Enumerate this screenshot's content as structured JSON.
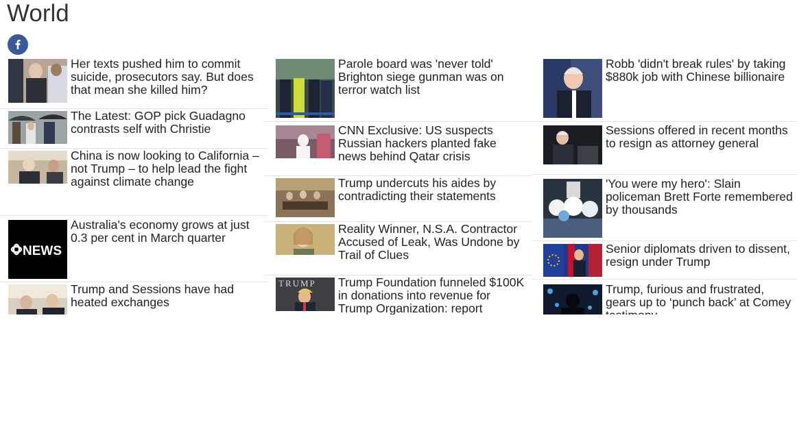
{
  "page": {
    "title": "World",
    "share_icon": "facebook-icon",
    "share_color": "#3b5998"
  },
  "columns": [
    {
      "stories": [
        {
          "headline": "Her texts pushed him to commit suicide, prosecutors say. But does that mean she killed him?",
          "image": "courtroom-photo"
        },
        {
          "headline": "The Latest: GOP pick Guadagno contrasts self with Christie",
          "image": "umbrellas-photo"
        },
        {
          "headline": "China is now looking to California – not Trump – to help lead the fight against climate change",
          "image": "meeting-photo"
        },
        {
          "headline": "Australia's economy grows at just 0.3 per cent in March quarter",
          "image": "abc-news-logo",
          "logo_text": "NEWS"
        },
        {
          "headline": "Trump and Sessions have had heated exchanges",
          "image": "oval-office-photo"
        }
      ]
    },
    {
      "stories": [
        {
          "headline": "Parole board was 'never told' Brighton siege gunman was on terror watch list",
          "image": "police-photo"
        },
        {
          "headline": "CNN Exclusive: US suspects Russian hackers planted fake news behind Qatar crisis",
          "image": "qatar-photo"
        },
        {
          "headline": "Trump undercuts his aides by contradicting their statements",
          "image": "cabinet-photo"
        },
        {
          "headline": "Reality Winner, N.S.A. Contractor Accused of Leak, Was Undone by Trail of Clues",
          "image": "portrait-photo"
        },
        {
          "headline": "Trump Foundation funneled $100K in donations into revenue for Trump Organization: report",
          "image": "trump-sign-photo",
          "logo_text": "TRUMP"
        }
      ]
    },
    {
      "stories": [
        {
          "headline": "Robb 'didn't break rules' by taking $880k job with Chinese billionaire",
          "image": "speaker-photo"
        },
        {
          "headline": "Sessions offered in recent months to resign as attorney general",
          "image": "podium-photo"
        },
        {
          "headline": "'You were my hero': Slain policeman Brett Forte remembered by thousands",
          "image": "funeral-flowers-photo"
        },
        {
          "headline": "Senior diplomats driven to dissent, resign under Trump",
          "image": "flags-photo"
        },
        {
          "headline": "Trump, furious and frustrated, gears up to ‘punch back’ at Comey testimony",
          "image": "twitter-silhouette-photo"
        }
      ]
    }
  ]
}
